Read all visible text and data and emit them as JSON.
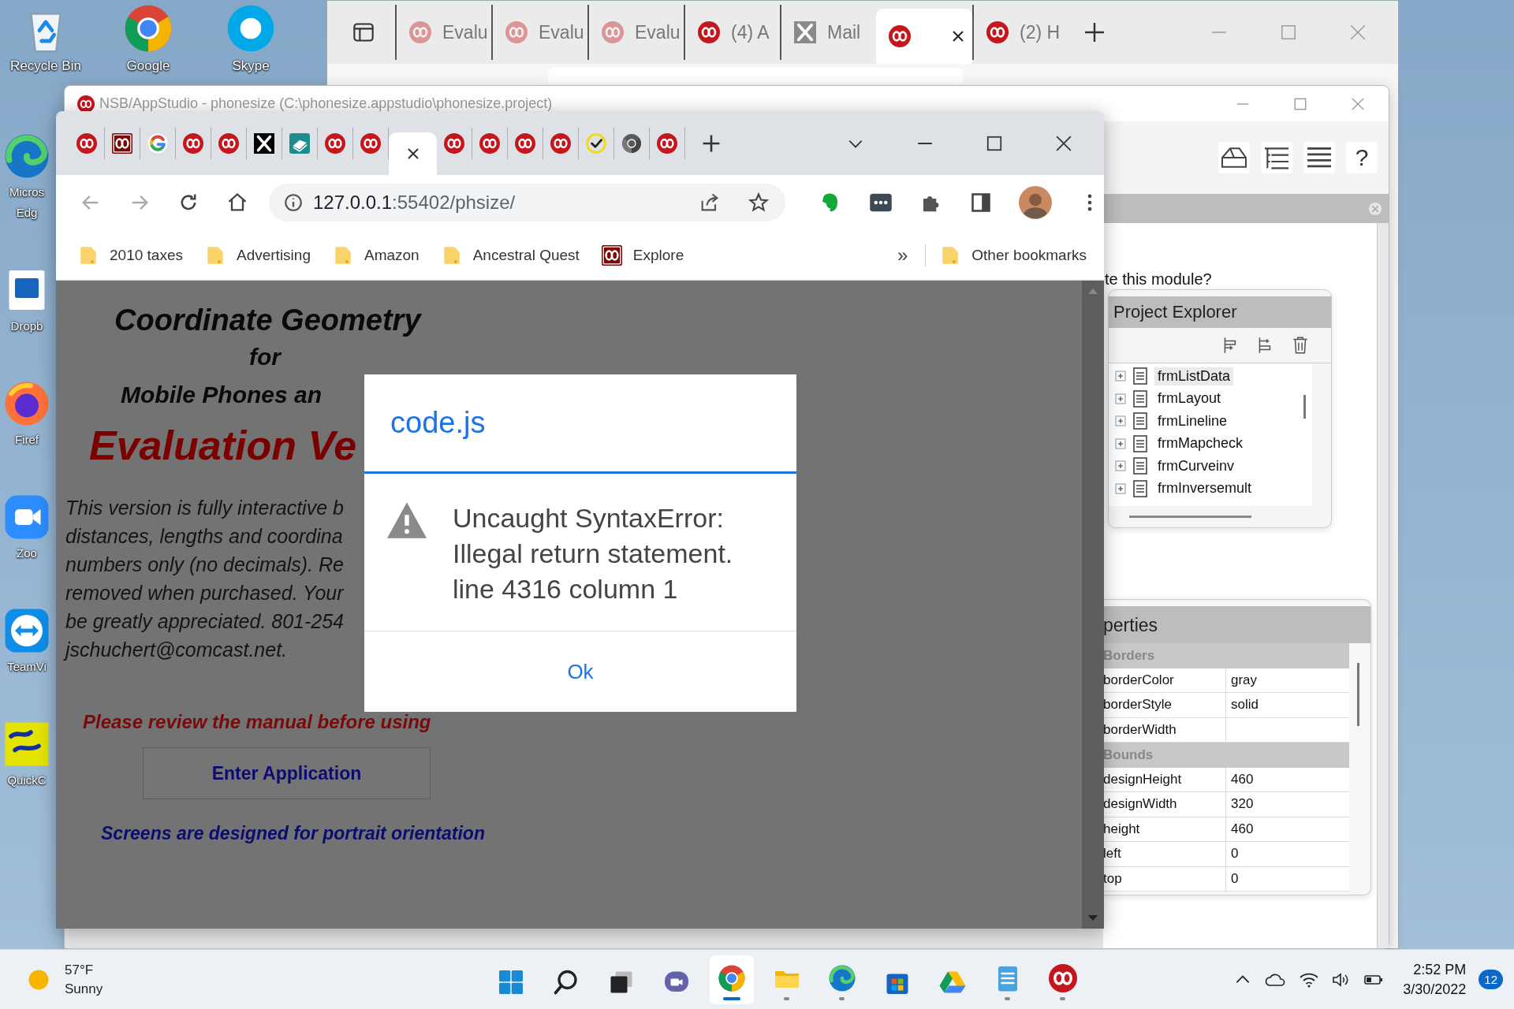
{
  "desktop": {
    "top_row": [
      {
        "kind": "recycle",
        "label": "Recycle Bin"
      },
      {
        "kind": "chrome",
        "label": "Google"
      },
      {
        "kind": "skype",
        "label": "Skype"
      }
    ],
    "left_column": [
      {
        "kind": "edge",
        "label": "Micros",
        "label_2": "Edg"
      },
      {
        "kind": "dropbox",
        "label": "Dropb"
      },
      {
        "kind": "firefox",
        "label": "Firef"
      },
      {
        "kind": "zoom",
        "label": "Zoo"
      },
      {
        "kind": "teamviewer",
        "label": "TeamVi"
      },
      {
        "kind": "quickcogo",
        "label": "QuickC"
      }
    ]
  },
  "edge_window": {
    "tabs": [
      {
        "kind": "app",
        "label": "Evalu",
        "faded": true,
        "selected": false
      },
      {
        "kind": "app",
        "label": "Evalu",
        "faded": true,
        "selected": false
      },
      {
        "kind": "app",
        "label": "Evalu",
        "faded": true,
        "selected": false
      },
      {
        "kind": "app",
        "label": "(4) A",
        "faded": false,
        "selected": false
      },
      {
        "kind": "x-gray",
        "label": "Mail",
        "faded": false,
        "selected": false
      },
      {
        "kind": "app",
        "faded": false,
        "selected": true
      },
      {
        "kind": "app",
        "label": "(2) H",
        "faded": false,
        "selected": false
      }
    ]
  },
  "appstudio": {
    "title": "NSB/AppStudio - phonesize (C:\\phonesize.appstudio\\phonesize.project)",
    "help": "?",
    "prompt": "te this module?",
    "project_explorer": {
      "title": "Project Explorer",
      "items": [
        {
          "label": "frmListData",
          "selected": true
        },
        {
          "label": "frmLayout",
          "selected": false
        },
        {
          "label": "frmLineline",
          "selected": false
        },
        {
          "label": "frmMapcheck",
          "selected": false
        },
        {
          "label": "frmCurveinv",
          "selected": false
        },
        {
          "label": "frmInversemult",
          "selected": false
        }
      ]
    },
    "properties": {
      "title": "perties",
      "groups": [
        {
          "name": "Borders",
          "rows": [
            {
              "name": "borderColor",
              "value": "gray"
            },
            {
              "name": "borderStyle",
              "value": "solid"
            },
            {
              "name": "borderWidth"
            }
          ]
        },
        {
          "name": "Bounds",
          "rows": [
            {
              "name": "designHeight",
              "value": "460"
            },
            {
              "name": "designWidth",
              "value": "320"
            },
            {
              "name": "height",
              "value": "460"
            },
            {
              "name": "left",
              "value": "0"
            },
            {
              "name": "top",
              "value": "0"
            }
          ]
        }
      ]
    }
  },
  "chrome": {
    "tabs": [
      {
        "kind": "app",
        "selected": false
      },
      {
        "kind": "app-square",
        "selected": false
      },
      {
        "kind": "google",
        "selected": false
      },
      {
        "kind": "app",
        "selected": false
      },
      {
        "kind": "app",
        "selected": false
      },
      {
        "kind": "x",
        "selected": false
      },
      {
        "kind": "book",
        "selected": false
      },
      {
        "kind": "app",
        "selected": false
      },
      {
        "kind": "app",
        "selected": false
      },
      {
        "selected": true
      },
      {
        "kind": "app",
        "selected": false
      },
      {
        "kind": "app",
        "selected": false
      },
      {
        "kind": "app",
        "selected": false
      },
      {
        "kind": "app",
        "selected": false
      },
      {
        "kind": "check",
        "selected": false
      },
      {
        "kind": "chrome-gray",
        "selected": false
      },
      {
        "kind": "app",
        "selected": false
      }
    ],
    "url_host": "127.0.0.1",
    "url_path": ":55402/phsize/",
    "bookmarks": [
      {
        "kind": "folder",
        "label": "2010 taxes"
      },
      {
        "kind": "folder",
        "label": "Advertising"
      },
      {
        "kind": "folder",
        "label": "Amazon"
      },
      {
        "kind": "folder",
        "label": "Ancestral Quest"
      },
      {
        "kind": "app",
        "label": "Explore"
      }
    ],
    "more": "»",
    "other_bookmarks": "Other bookmarks"
  },
  "page": {
    "heading": "Coordinate Geometry",
    "for": "for",
    "subheading": "Mobile Phones an",
    "edition": "Evaluation Ve",
    "paragraph_lines": [
      "This version is fully interactive b",
      "distances, lengths and coordina",
      "numbers only (no decimals). Re",
      "removed when purchased. Your",
      "be greatly appreciated. 801-254",
      "jschuchert@comcast.net."
    ],
    "notice": "Please review the manual before using",
    "button": "Enter Application",
    "footer": "Screens are designed for portrait orientation"
  },
  "dialog": {
    "title": "code.js",
    "message_lines": [
      "Uncaught SyntaxError:",
      "Illegal return statement.",
      "line 4316 column 1"
    ],
    "button": "Ok"
  },
  "taskbar": {
    "weather": {
      "temperature": "57°F",
      "condition": "Sunny"
    },
    "apps": [
      {
        "kind": "start",
        "selected": false,
        "running": false
      },
      {
        "kind": "search",
        "selected": false,
        "running": false
      },
      {
        "kind": "taskview",
        "selected": false,
        "running": false
      },
      {
        "kind": "teams",
        "selected": false,
        "running": false
      },
      {
        "kind": "chrome",
        "selected": true,
        "running": true
      },
      {
        "kind": "explorer",
        "selected": false,
        "running": true
      },
      {
        "kind": "edge",
        "selected": false,
        "running": true
      },
      {
        "kind": "store",
        "selected": false,
        "running": false
      },
      {
        "kind": "drive",
        "selected": false,
        "running": false
      },
      {
        "kind": "notepad",
        "selected": false,
        "running": true
      },
      {
        "kind": "app",
        "selected": false,
        "running": true
      }
    ],
    "time": "2:52 PM",
    "date": "3/30/2022",
    "notifications": "12"
  }
}
